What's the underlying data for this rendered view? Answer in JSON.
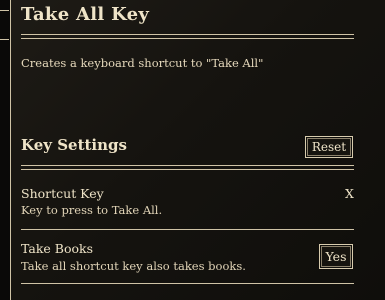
{
  "mod": {
    "title": "Take All Key",
    "description": "Creates a keyboard shortcut to \"Take All\""
  },
  "section": {
    "title": "Key Settings",
    "reset_label": "Reset"
  },
  "settings": [
    {
      "title": "Shortcut Key",
      "description": "Key to press to Take All.",
      "value": "X"
    },
    {
      "title": "Take Books",
      "description": "Take all shortcut key also takes books.",
      "value": "Yes"
    }
  ]
}
